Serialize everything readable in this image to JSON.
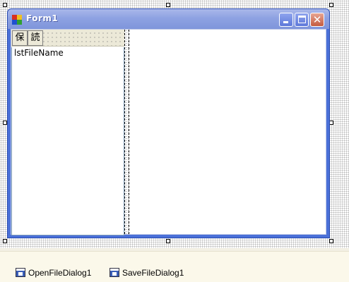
{
  "form": {
    "title": "Form1"
  },
  "toolstrip": {
    "buttons": [
      {
        "label": "保"
      },
      {
        "label": "読"
      }
    ]
  },
  "listbox": {
    "name": "lstFileName"
  },
  "tray": {
    "components": [
      {
        "label": "OpenFileDialog1",
        "icon": "open-file-dialog-icon"
      },
      {
        "label": "SaveFileDialog1",
        "icon": "save-file-dialog-icon"
      }
    ]
  },
  "colors": {
    "title_bar": "#8ea2e2",
    "form_frame": "#4a70d8",
    "close_button": "#c45b3f",
    "tray_background": "#fbf8ea"
  }
}
